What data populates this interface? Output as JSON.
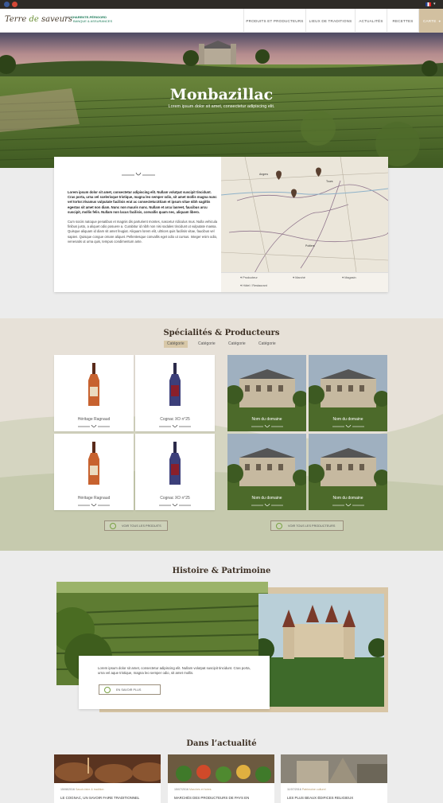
{
  "header": {
    "logo_main": "Terre ",
    "logo_de": "de",
    "logo_end": " saveurs",
    "partner_by": "PAR",
    "partner_name": "CHARENTE-PÉRIGORD",
    "partner_sub": "BANQUE & ASSURANCES",
    "nav": [
      "PRODUITS ET PRODUCTEURS",
      "LIEUX DE TRADITIONS",
      "ACTUALITÉS",
      "RECETTES",
      "CARTE"
    ]
  },
  "hero": {
    "title": "Monbazillac",
    "subtitle": "Lorem ipsum dolor sit amet, consectetur adipiscing elit."
  },
  "intro": {
    "p1_bold": "Lorem ipsum dolor sit amet, consectetur adipiscing elit. Nullam volutpat suscipit tincidunt. Cras porta, urna vel scelerisque tristique, magna leo semper odio, sit amet mollis magna nunc vel tortor.Vivamus vulputate facilisis erat ac consectetur.Etiam et ipsum vitae nibh sagittis egestas sit amet non diam. Nunc non mauris nunc. Nullam et arcu laoreet, faucibus arcu suscipit, mollis felis. Nullam non lacus facilisis, convallis quam nec, aliquam libero.",
    "p2": "Cum sociis natoque penatibus et magnis dis parturient montes, nascetur ridiculus mus. Nulla vehicula finibus justo, a aliquet odio posuere a. Curabitur id nibh non nisi sodales tincidunt ut vulputate massa. Quisque aliquam id diam sit amet feugiat. Aliquam lorem elit, ultrices quis facilisis vitae, faucibus vel sapien. Quisque congue ornare aliquet. Pellentesque convallis eget odio ut cursus. Integer enim odio, venenatis ut urna quis, tempus condimentum ante."
  },
  "map": {
    "cities": [
      "Angers",
      "Tours",
      "Poitiers"
    ],
    "legend": [
      "Producteur",
      "Marché",
      "Magasin",
      "Hôtel / Restaurant"
    ]
  },
  "specialites": {
    "title": "Spécialités & Producteurs",
    "categories": [
      "Catégorie",
      "Catégorie",
      "Catégorie",
      "Catégorie"
    ],
    "products": [
      {
        "name": "Héritage Ragnaud"
      },
      {
        "name": "Cognac XO n°25"
      },
      {
        "name": "Héritage Ragnaud"
      },
      {
        "name": "Cognac XO n°25"
      }
    ],
    "producers": [
      "Nom du domaine",
      "Nom du domaine",
      "Nom du domaine",
      "Nom du domaine"
    ],
    "btn_products": "VOIR TOUS LES PRODUITS",
    "btn_producers": "VOIR TOUS LES PRODUCTEURS"
  },
  "histoire": {
    "title": "Histoire  & Patrimoine",
    "text": "Lorem ipsum dolor sit amet, consectetur adipiscing elit. Nullam volutpat suscipit tincidunt. Cras porta, urna vel  aque tristique, magna leo semper odio, sit amet mollis.",
    "btn": "EN SAVOIR PLUS"
  },
  "actualite": {
    "title": "Dans l’actualité",
    "items": [
      {
        "date": "15/08/2016",
        "cat": "Savoir-faire & tradition",
        "title": "LE COGNAC, UN SAVOIR FAIRE TRADITIONNEL"
      },
      {
        "date": "15/07/2016",
        "cat": "Marchés et foires",
        "title": "MARCHÉS DES PRODUCTEURS DE PAYS EN"
      },
      {
        "date": "11/07/2016",
        "cat": "Patrimoine culturel",
        "title": "LES PLUS BEAUX ÉDIFICES RELIGIEUX"
      }
    ]
  },
  "colors": {
    "accent": "#b69a6d",
    "green": "#7aa244",
    "dark": "#2e2b27"
  }
}
